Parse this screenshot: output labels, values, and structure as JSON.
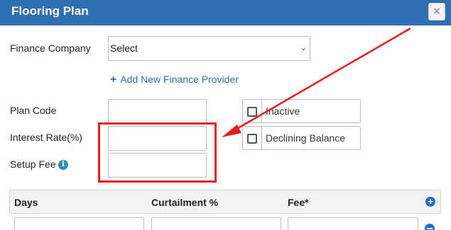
{
  "dialog": {
    "title": "Flooring Plan",
    "close_glyph": "×"
  },
  "form": {
    "finance_company": {
      "label": "Finance Company",
      "value": "Select",
      "chevron": "⌄"
    },
    "add_provider": {
      "plus": "+",
      "label": "Add New Finance Provider"
    },
    "plan_code": {
      "label": "Plan Code",
      "value": ""
    },
    "interest_rate": {
      "label": "Interest Rate(%)",
      "value": ""
    },
    "setup_fee": {
      "label": "Setup Fee",
      "value": "",
      "info_glyph": "i"
    },
    "inactive": {
      "label": "Inactive",
      "checked": false
    },
    "declining_balance": {
      "label": "Declining Balance",
      "checked": false
    }
  },
  "table": {
    "columns": [
      "Days",
      "Curtailment %",
      "Fee*"
    ],
    "add_glyph": "+"
  },
  "colors": {
    "header": "#2f6db5",
    "link": "#2f6db5",
    "annotation": "#e61c1c",
    "icon": "#1f6fd6"
  },
  "icons": {
    "close": "close-icon",
    "add": "plus-icon",
    "info": "info-icon",
    "add_row": "plus-circle-icon",
    "remove_row": "minus-circle-icon"
  }
}
